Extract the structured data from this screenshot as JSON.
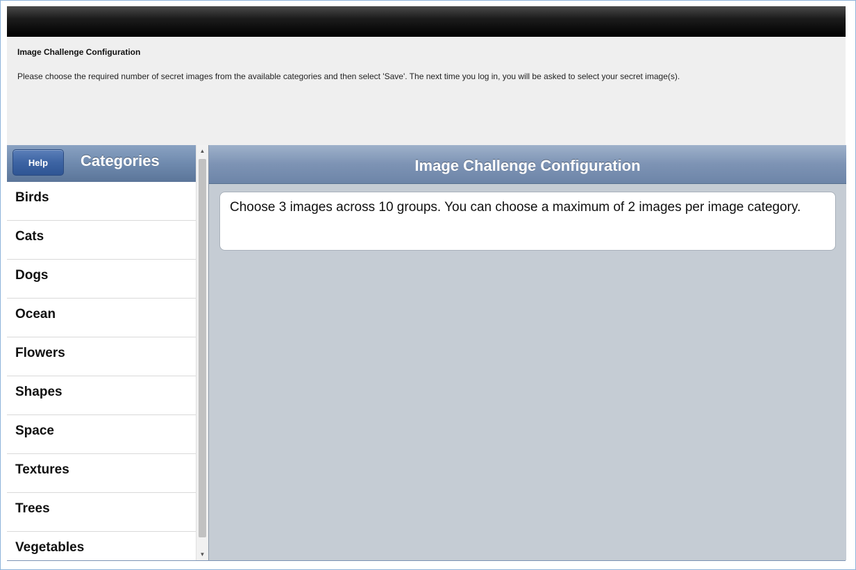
{
  "info": {
    "title": "Image Challenge Configuration",
    "text": "Please choose the required number of secret images from the available categories and then select 'Save'. The next time you log in, you will be asked to select your secret image(s)."
  },
  "sidebar": {
    "help_label": "Help",
    "title": "Categories",
    "items": [
      {
        "label": "Birds"
      },
      {
        "label": "Cats"
      },
      {
        "label": "Dogs"
      },
      {
        "label": "Ocean"
      },
      {
        "label": "Flowers"
      },
      {
        "label": "Shapes"
      },
      {
        "label": "Space"
      },
      {
        "label": "Textures"
      },
      {
        "label": "Trees"
      },
      {
        "label": "Vegetables"
      }
    ]
  },
  "main": {
    "title": "Image Challenge Configuration",
    "message": "Choose 3 images across 10 groups. You can choose a maximum of 2 images per image category."
  },
  "icons": {
    "scroll_up": "scroll-up-arrow-icon",
    "scroll_down": "scroll-down-arrow-icon"
  },
  "colors": {
    "header_blue": "#7d93b4",
    "main_background": "#c5ccd4",
    "help_button": "#3d64a3"
  }
}
